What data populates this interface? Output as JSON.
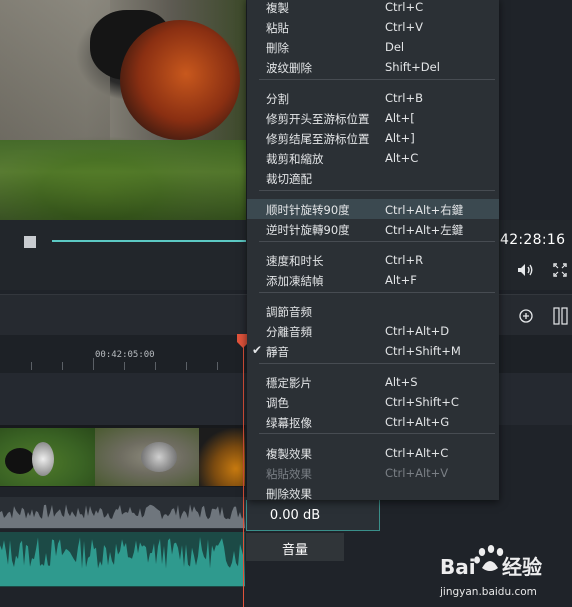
{
  "player": {
    "timecode": "42:28:16",
    "progress_fraction": 0.9,
    "icons": [
      "stop-icon",
      "volume-icon",
      "fullscreen-icon",
      "zoom-in-icon",
      "layout-icon"
    ]
  },
  "timeline": {
    "ruler_label": "00:42:05:00"
  },
  "audio_popup": {
    "db_value": "0.00 dB",
    "label": "音量"
  },
  "context_menu": {
    "items": [
      {
        "label": "複製",
        "shortcut": "Ctrl+C"
      },
      {
        "label": "粘貼",
        "shortcut": "Ctrl+V"
      },
      {
        "label": "刪除",
        "shortcut": "Del"
      },
      {
        "label": "波纹删除",
        "shortcut": "Shift+Del"
      },
      {
        "label": "分割",
        "shortcut": "Ctrl+B"
      },
      {
        "label": "修剪开头至游标位置",
        "shortcut": "Alt+["
      },
      {
        "label": "修剪结尾至游标位置",
        "shortcut": "Alt+]"
      },
      {
        "label": "裁剪和縮放",
        "shortcut": "Alt+C"
      },
      {
        "label": "裁切適配",
        "shortcut": ""
      },
      {
        "label": "顺时针旋转90度",
        "shortcut": "Ctrl+Alt+右鍵"
      },
      {
        "label": "逆时针旋轉90度",
        "shortcut": "Ctrl+Alt+左鍵"
      },
      {
        "label": "速度和时长",
        "shortcut": "Ctrl+R"
      },
      {
        "label": "添加凍結幀",
        "shortcut": "Alt+F"
      },
      {
        "label": "調節音频",
        "shortcut": ""
      },
      {
        "label": "分離音頻",
        "shortcut": "Ctrl+Alt+D"
      },
      {
        "label": "靜音",
        "shortcut": "Ctrl+Shift+M"
      },
      {
        "label": "穩定影片",
        "shortcut": "Alt+S"
      },
      {
        "label": "调色",
        "shortcut": "Ctrl+Shift+C"
      },
      {
        "label": "绿幕抠像",
        "shortcut": "Ctrl+Alt+G"
      },
      {
        "label": "複製效果",
        "shortcut": "Ctrl+Alt+C"
      },
      {
        "label": "粘貼效果",
        "shortcut": "Ctrl+Alt+V"
      },
      {
        "label": "刪除效果",
        "shortcut": ""
      }
    ],
    "highlighted_index": 9,
    "checked_index": 15,
    "disabled_index": 20
  },
  "watermark": {
    "brand": "Bai经验",
    "url": "jingyan.baidu.com"
  },
  "colors": {
    "accent": "#5cc9c4",
    "playhead": "#e0533b",
    "menu_bg": "#2b3035",
    "menu_highlight": "#3b4950"
  }
}
